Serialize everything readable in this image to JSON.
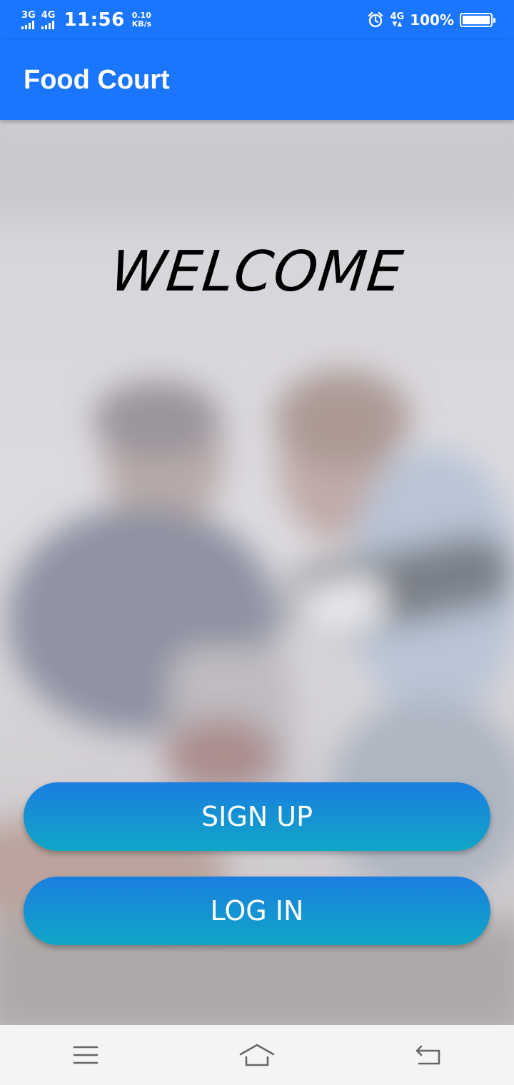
{
  "status_bar": {
    "net1": "3G",
    "net2": "4G",
    "time": "11:56",
    "speed_value": "0.10",
    "speed_unit": "KB/s",
    "net3": "4G",
    "battery": "100%",
    "battery_level": 1.0,
    "icons": [
      "signal-icon",
      "alarm-icon",
      "battery-icon"
    ]
  },
  "app_bar": {
    "title": "Food Court"
  },
  "main": {
    "welcome": "WELCOME",
    "signup_label": "SIGN UP",
    "login_label": "LOG IN"
  },
  "nav_bar": {
    "icons": [
      "menu-icon",
      "home-icon",
      "back-icon"
    ]
  },
  "colors": {
    "primary": "#1a75ff",
    "button_top": "#1a7ee0",
    "button_bottom": "#10a6c6"
  }
}
